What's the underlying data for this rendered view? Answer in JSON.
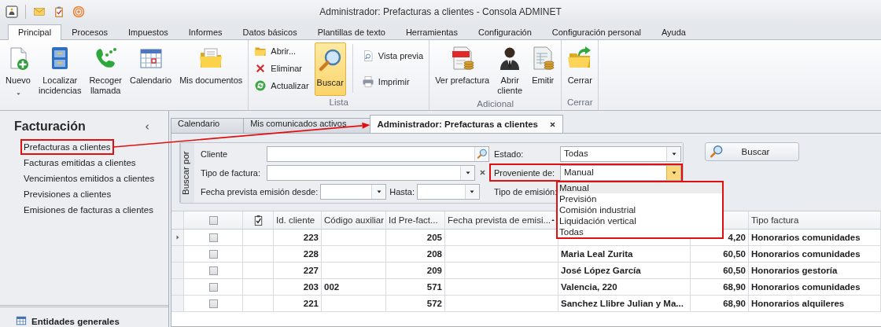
{
  "window": {
    "title": "Administrador: Prefacturas a clientes - Consola ADMINET"
  },
  "ribbon_tabs": [
    {
      "label": "Principal",
      "selected": true
    },
    {
      "label": "Procesos",
      "selected": false
    },
    {
      "label": "Impuestos",
      "selected": false
    },
    {
      "label": "Informes",
      "selected": false
    },
    {
      "label": "Datos básicos",
      "selected": false
    },
    {
      "label": "Plantillas de texto",
      "selected": false
    },
    {
      "label": "Herramientas",
      "selected": false
    },
    {
      "label": "Configuración",
      "selected": false
    },
    {
      "label": "Configuración personal",
      "selected": false
    },
    {
      "label": "Ayuda",
      "selected": false
    }
  ],
  "ribbon_groups": [
    {
      "items": [
        {
          "label": "Nuevo",
          "kind": "large",
          "active": false,
          "dropdown": true
        },
        {
          "label": "Localizar\nincidencias",
          "kind": "large",
          "active": false
        },
        {
          "label": "Recoger\nllamada",
          "kind": "large",
          "active": false
        },
        {
          "label": "Calendario",
          "kind": "large",
          "active": false
        },
        {
          "label": "Mis documentos",
          "kind": "large",
          "active": false
        }
      ]
    },
    {
      "label": "Lista",
      "items": [
        {
          "label": "Abrir...",
          "kind": "small"
        },
        {
          "label": "Eliminar",
          "kind": "small"
        },
        {
          "label": "Actualizar",
          "kind": "small"
        },
        {
          "label": "Buscar",
          "kind": "large",
          "active": true
        },
        {
          "label": "Vista previa",
          "kind": "small",
          "separator_before": true
        },
        {
          "label": "Imprimir",
          "kind": "small"
        }
      ]
    },
    {
      "label": "Adicional",
      "items": [
        {
          "label": "Ver prefactura",
          "kind": "large",
          "active": false
        },
        {
          "label": "Abrir\ncliente",
          "kind": "large",
          "active": false
        },
        {
          "label": "Emitir",
          "kind": "large",
          "active": false
        }
      ]
    },
    {
      "label": "Cerrar",
      "items": [
        {
          "label": "Cerrar",
          "kind": "large",
          "active": false
        }
      ]
    }
  ],
  "sidebar": {
    "title": "Facturación",
    "items": [
      {
        "label": "Prefacturas a clientes",
        "annotated": true
      },
      {
        "label": "Facturas emitidas a clientes",
        "annotated": false
      },
      {
        "label": "Vencimientos emitidos a clientes",
        "annotated": false
      },
      {
        "label": "Previsiones a clientes",
        "annotated": false
      },
      {
        "label": "Emisiones de facturas a clientes",
        "annotated": false
      }
    ],
    "footer": "Entidades generales"
  },
  "annotation_arrow": true,
  "document_tabs": [
    {
      "label": "Calendario",
      "selected": false
    },
    {
      "label": "Mis comunicados activos",
      "selected": false
    },
    {
      "label": "Administrador: Prefacturas a clientes",
      "selected": true,
      "closable": true
    }
  ],
  "search": {
    "caption": "Buscar por",
    "cliente": {
      "label": "Cliente"
    },
    "estado": {
      "label": "Estado:",
      "value": "Todas"
    },
    "tipo_factura": {
      "label": "Tipo de factura:"
    },
    "proveniente": {
      "label": "Proveniente de:",
      "value": "Manual",
      "open": true,
      "annotated": true,
      "options": [
        {
          "label": "Manual",
          "selected": true
        },
        {
          "label": "Previsión",
          "selected": false
        },
        {
          "label": "Comisión industrial",
          "selected": false
        },
        {
          "label": "Liquidación vertical",
          "selected": false
        },
        {
          "label": "Todas",
          "selected": false
        }
      ]
    },
    "fecha_desde": {
      "label": "Fecha prevista emisión desde:"
    },
    "hasta": {
      "label": "Hasta:"
    },
    "tipo_emision": {
      "label": "Tipo de emisión:"
    },
    "button": "Buscar"
  },
  "table": {
    "header_checked": false,
    "columns": [
      {
        "kind": "number",
        "label": "Id. cliente"
      },
      {
        "kind": "text",
        "label": "Código auxiliar"
      },
      {
        "kind": "number",
        "label": "Id Pre-fact..."
      },
      {
        "kind": "text",
        "label": "Fecha prevista de emisi...",
        "sorted_ascending": true
      },
      {
        "kind": "text"
      },
      {
        "kind": "number"
      },
      {
        "kind": "text",
        "label": "Tipo factura"
      }
    ],
    "rows": [
      {
        "selected": true,
        "checked": false,
        "cells": [
          "223",
          null,
          "205",
          null,
          null,
          "4,20",
          "Honorarios comunidades"
        ]
      },
      {
        "selected": false,
        "checked": false,
        "cells": [
          "228",
          null,
          "208",
          null,
          "Maria Leal Zurita",
          "60,50",
          "Honorarios comunidades"
        ]
      },
      {
        "selected": false,
        "checked": false,
        "cells": [
          "227",
          null,
          "209",
          null,
          "José López García",
          "60,50",
          "Honorarios gestoría"
        ]
      },
      {
        "selected": false,
        "checked": false,
        "cells": [
          "203",
          "002",
          "571",
          null,
          "Valencia, 220",
          "68,90",
          "Honorarios comunidades"
        ]
      },
      {
        "selected": false,
        "checked": false,
        "cells": [
          "221",
          null,
          "572",
          null,
          "Sanchez Llibre Julian y Ma...",
          "68,90",
          "Honorarios alquileres"
        ]
      }
    ]
  }
}
